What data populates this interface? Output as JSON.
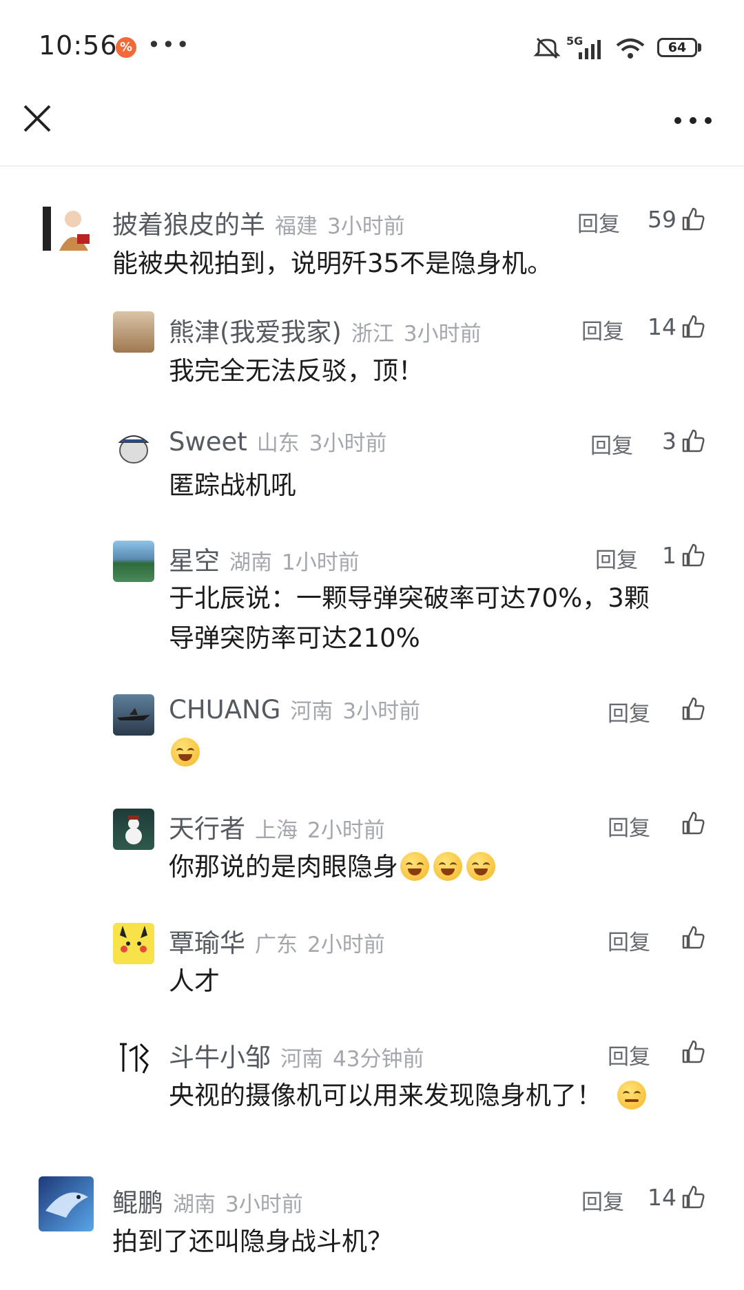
{
  "status_bar": {
    "time": "10:56",
    "app_badge": "%",
    "more": "•••",
    "network": "5G",
    "battery": "64"
  },
  "header": {
    "close_icon": "close-icon",
    "more_icon": "more-horizontal-icon"
  },
  "comments": [
    {
      "user": "披着狼皮的羊",
      "location": "福建",
      "time": "3小时前",
      "reply": "回复",
      "likes": "59",
      "text": "能被央视拍到，说明歼35不是隐身机。",
      "replies": [
        {
          "user": "熊津(我爱我家)",
          "location": "浙江",
          "time": "3小时前",
          "reply": "回复",
          "likes": "14",
          "text": "我完全无法反驳，顶！"
        },
        {
          "user": "Sweet",
          "location": "山东",
          "time": "3小时前",
          "reply": "回复",
          "likes": "3",
          "text": "匿踪战机吼"
        },
        {
          "user": "星空",
          "location": "湖南",
          "time": "1小时前",
          "reply": "回复",
          "likes": "1",
          "text_line1": "于北辰说：一颗导弹突破率可达70%，3颗",
          "text_line2": "导弹突防率可达210%"
        },
        {
          "user": "CHUANG",
          "location": "河南",
          "time": "3小时前",
          "reply": "回复",
          "likes": ""
        },
        {
          "user": "天行者",
          "location": "上海",
          "time": "2小时前",
          "reply": "回复",
          "likes": "",
          "text": "你那说的是肉眼隐身"
        },
        {
          "user": "覃瑜华",
          "location": "广东",
          "time": "2小时前",
          "reply": "回复",
          "likes": "",
          "text": "人才"
        },
        {
          "user": "斗牛小邹",
          "location": "河南",
          "time": "43分钟前",
          "reply": "回复",
          "likes": "",
          "text": "央视的摄像机可以用来发现隐身机了！"
        }
      ]
    },
    {
      "user": "鲲鹏",
      "location": "湖南",
      "time": "3小时前",
      "reply": "回复",
      "likes": "14",
      "text": "拍到了还叫隐身战斗机？"
    }
  ]
}
